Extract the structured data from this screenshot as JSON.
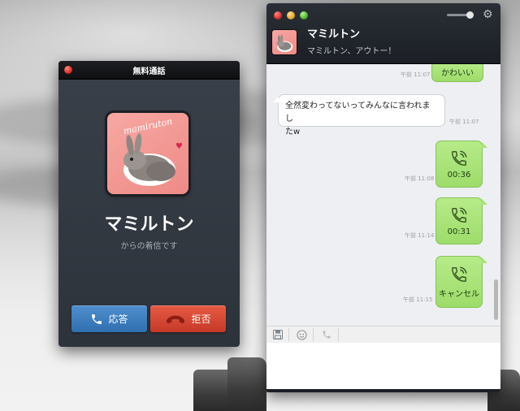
{
  "call_window": {
    "title": "無料通話",
    "caller_name": "マミルトン",
    "subtext": "からの着信です",
    "answer_label": "応答",
    "decline_label": "拒否",
    "avatar_text": "mamiruton"
  },
  "chat_window": {
    "contact_name": "マミルトン",
    "status_message": "マミルトン、アウトー！",
    "input_placeholder": "",
    "messages": [
      {
        "direction": "out",
        "type": "text",
        "text": "かわいい",
        "time": "午前 11:07"
      },
      {
        "direction": "in",
        "type": "text",
        "lines": [
          "全然変わってないってみんなに言われまし",
          "たw"
        ],
        "time": "午前 11:07"
      },
      {
        "direction": "out",
        "type": "call",
        "label": "00:36",
        "time": "午前 11:08"
      },
      {
        "direction": "out",
        "type": "call",
        "label": "00:31",
        "time": "午前 11:14"
      },
      {
        "direction": "out",
        "type": "call",
        "label": "キャンセル",
        "time": "午前 11:15"
      }
    ]
  },
  "colors": {
    "bubble_out": "#a7e276",
    "answer_button": "#3f7fbf",
    "decline_button": "#d64a35",
    "header_dark": "#1f242b"
  },
  "icons": {
    "phone": "phone-icon",
    "settings": "gear-icon",
    "save": "floppy-icon",
    "sticker": "emoticon-icon"
  }
}
